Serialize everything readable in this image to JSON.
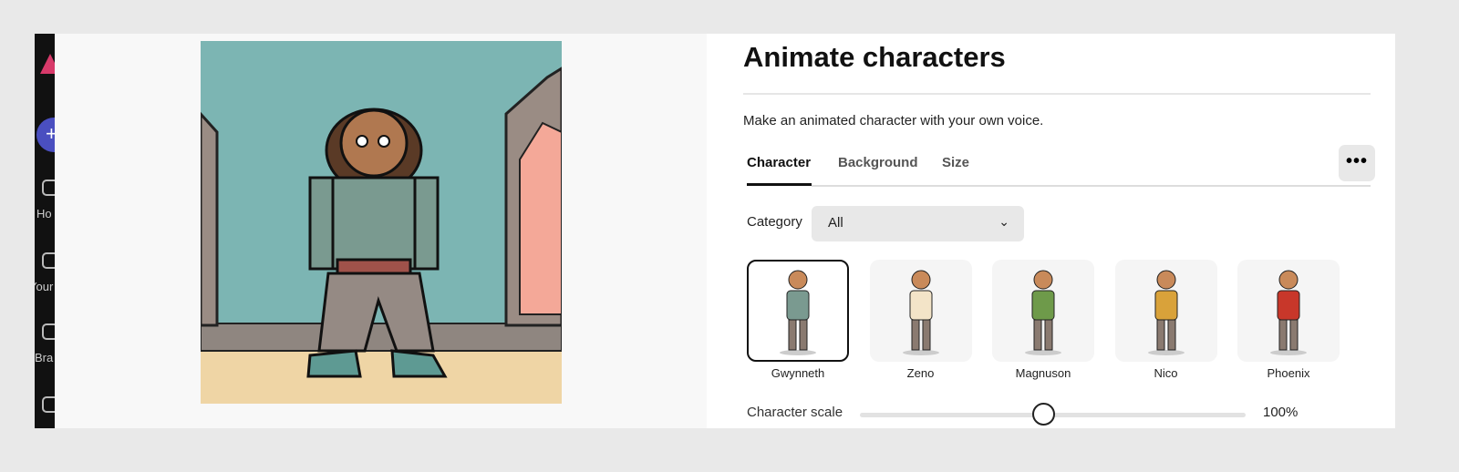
{
  "sidebar": {
    "items": [
      {
        "label": "Ho",
        "icon": "home-icon"
      },
      {
        "label": "Your",
        "icon": "folder-icon"
      },
      {
        "label": "Bra",
        "icon": "brand-icon"
      },
      {
        "label": "",
        "icon": "apps-icon"
      }
    ]
  },
  "panel": {
    "title": "Animate characters",
    "description": "Make an animated character with your own voice.",
    "tabs": [
      {
        "label": "Character",
        "active": true
      },
      {
        "label": "Background"
      },
      {
        "label": "Size"
      }
    ],
    "more_label": "•••",
    "category": {
      "label": "Category",
      "value": "All"
    },
    "characters": [
      {
        "name": "Gwynneth",
        "selected": true,
        "color": "#7a9a90"
      },
      {
        "name": "Zeno",
        "color": "#f3e4c8"
      },
      {
        "name": "Magnuson",
        "color": "#6e9a4a"
      },
      {
        "name": "Nico",
        "color": "#d9a23a"
      },
      {
        "name": "Phoenix",
        "color": "#c8372a"
      }
    ],
    "scale": {
      "label": "Character scale",
      "value": "100%",
      "percent": 100
    }
  }
}
